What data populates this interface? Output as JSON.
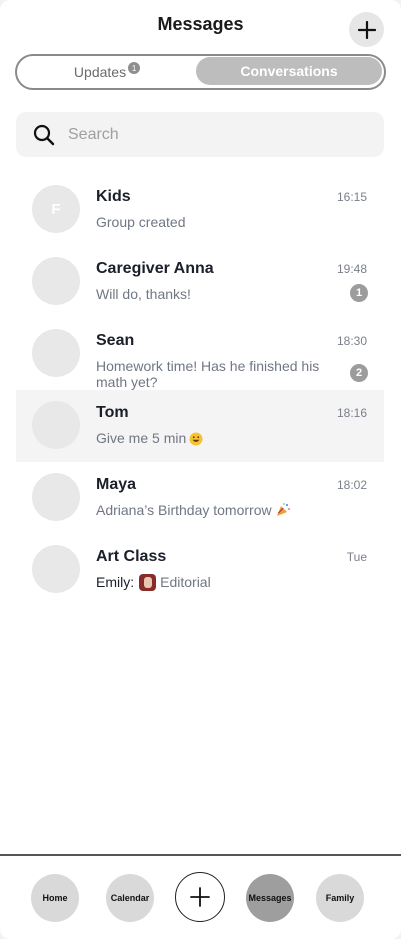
{
  "header": {
    "title": "Messages",
    "add_icon": "plus-icon"
  },
  "tabs": {
    "updates_label": "Updates",
    "updates_badge": "1",
    "conversations_label": "Conversations",
    "active": "Conversations"
  },
  "search": {
    "placeholder": "Search",
    "icon": "search-icon"
  },
  "conversations": [
    {
      "initial": "F",
      "name": "Kids",
      "time": "16:15",
      "preview": "Group created",
      "unread": ""
    },
    {
      "initial": "",
      "name": "Caregiver Anna",
      "time": "19:48",
      "preview": "Will do, thanks!",
      "unread": "1"
    },
    {
      "initial": "",
      "name": "Sean",
      "time": "18:30",
      "preview": "Homework time! Has he finished his math yet?",
      "unread": "2"
    },
    {
      "initial": "",
      "name": "Tom",
      "time": "18:16",
      "preview": "Give me 5 min",
      "unread": "",
      "emoji": "grinning-face-emoji",
      "selected": true
    },
    {
      "initial": "",
      "name": "Maya",
      "time": "18:02",
      "preview": "Adriana’s Birthday tomorrow",
      "unread": "",
      "emoji": "party-popper-emoji"
    },
    {
      "initial": "",
      "name": "Art Class",
      "time": "Tue",
      "preview_sender": "Emily:",
      "preview": "Editorial",
      "unread": "",
      "attachment": "image-thumbnail-icon"
    }
  ],
  "bottom_nav": {
    "home": "Home",
    "calendar": "Calendar",
    "add_icon": "plus-icon",
    "messages": "Messages",
    "family": "Family",
    "active": "Messages"
  },
  "colors": {
    "segment_active": "#bdbdbd",
    "badge": "#9c9c9c",
    "nav_active": "#9e9e9e",
    "nav_inactive": "#d9d9d9"
  }
}
